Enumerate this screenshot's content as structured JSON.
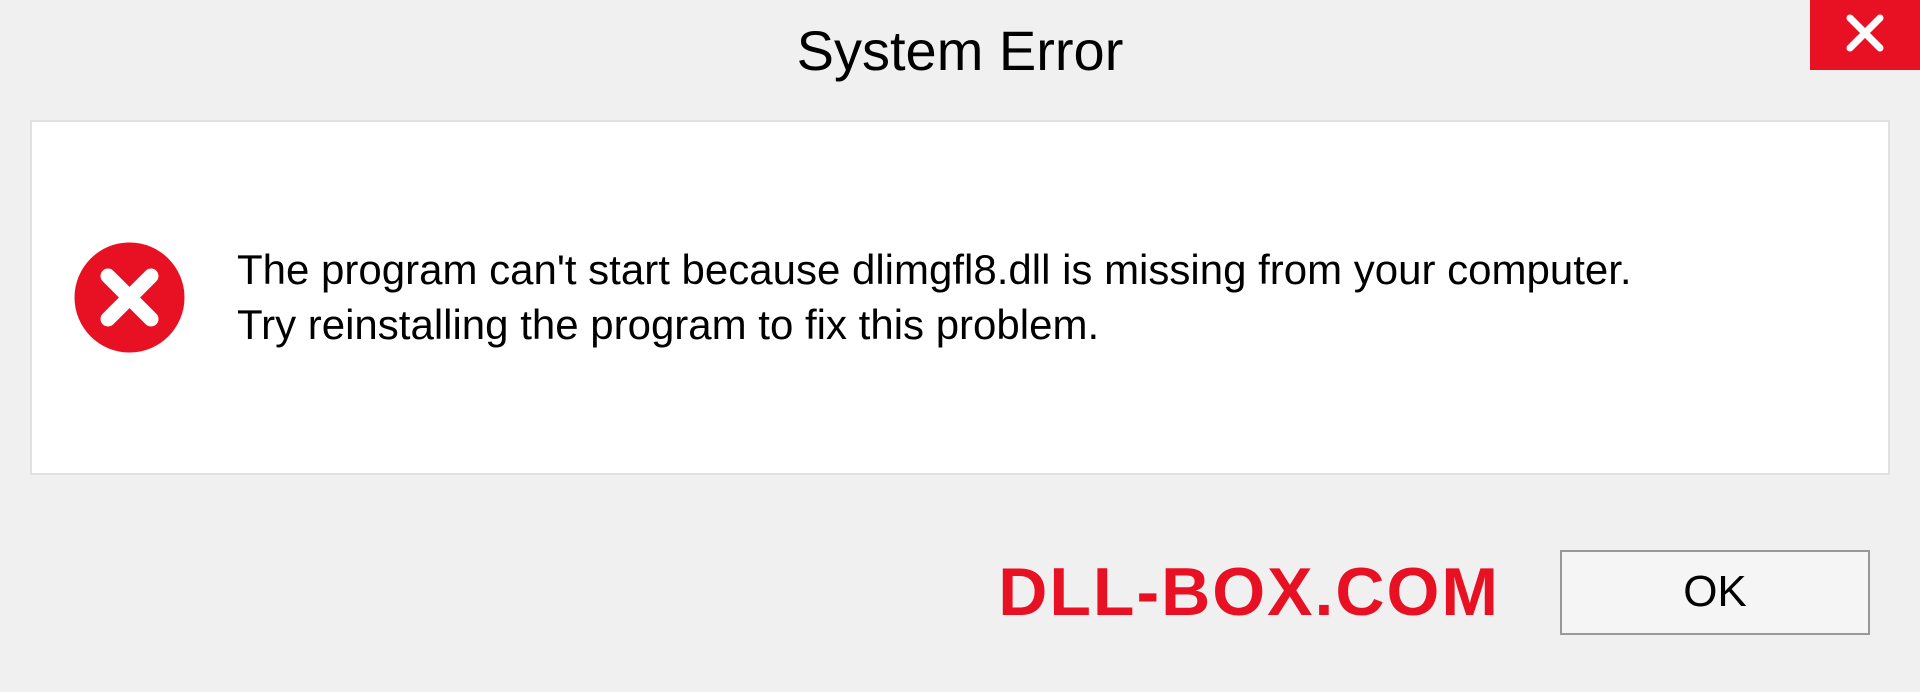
{
  "dialog": {
    "title": "System Error",
    "message": "The program can't start because dlimgfl8.dll is missing from your computer.\nTry reinstalling the program to fix this problem.",
    "ok_label": "OK"
  },
  "watermark": "DLL-BOX.COM",
  "colors": {
    "accent_red": "#e81123"
  }
}
